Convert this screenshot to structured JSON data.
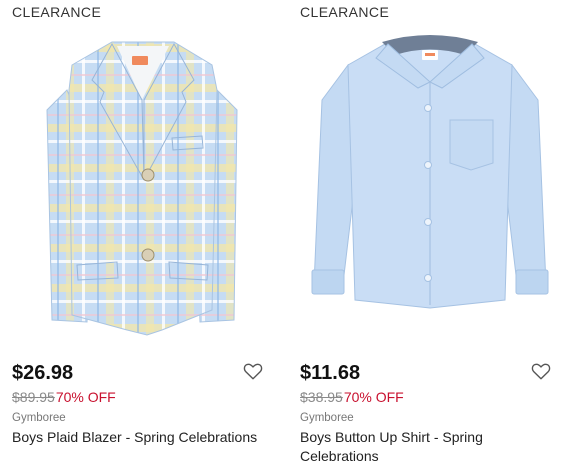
{
  "products": [
    {
      "badge": "CLEARANCE",
      "price": "$26.98",
      "original_price": "$89.95",
      "discount": "70% OFF",
      "brand": "Gymboree",
      "name": "Boys Plaid Blazer - Spring Celebrations",
      "image_icon": "plaid-blazer-image",
      "wishlist_icon": "heart-outline-icon",
      "colors": {
        "main": "#b9d3ef",
        "accent": "#f3e7a8"
      }
    },
    {
      "badge": "CLEARANCE",
      "price": "$11.68",
      "original_price": "$38.95",
      "discount": "70% OFF",
      "brand": "Gymboree",
      "name": "Boys Button Up Shirt - Spring Celebrations",
      "image_icon": "button-up-shirt-image",
      "wishlist_icon": "heart-outline-icon",
      "colors": {
        "main": "#c7dcf4"
      }
    }
  ],
  "theme": {
    "discount_color": "#c8102e",
    "strike_color": "#8a8a8a"
  }
}
